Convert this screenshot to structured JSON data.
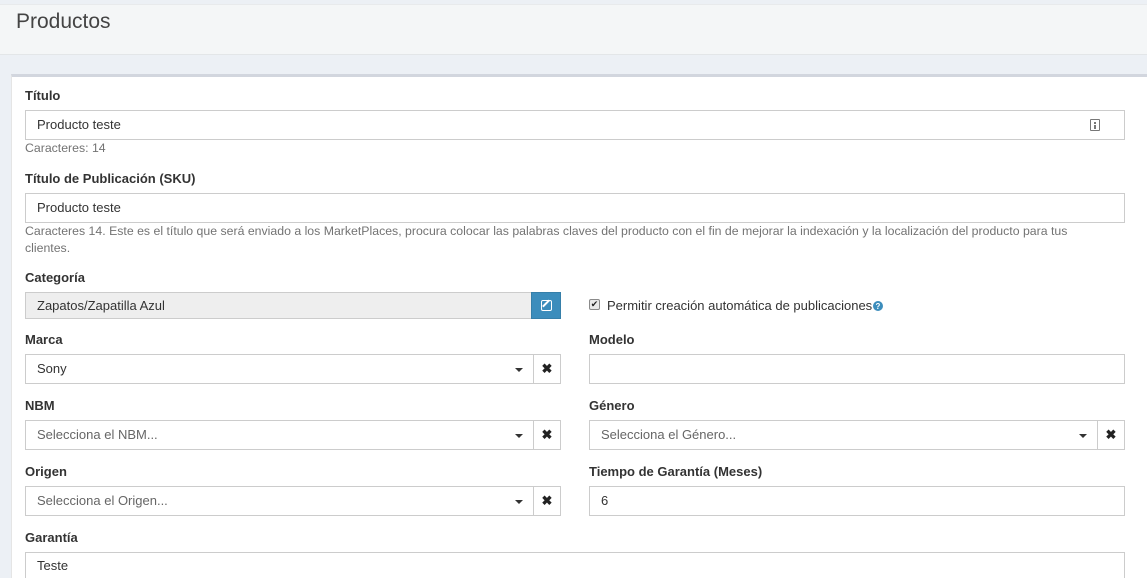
{
  "header": {
    "title": "Productos"
  },
  "form": {
    "titulo": {
      "label": "Título",
      "value": "Producto teste",
      "counter": "Caracteres: 14"
    },
    "titulo_publicacion": {
      "label": "Título de Publicación (SKU)",
      "value": "Producto teste",
      "help": "Caracteres 14. Este es el título que será enviado a los MarketPlaces, procura colocar las palabras claves del producto con el fin de mejorar la indexación y la localización del producto para tus clientes."
    },
    "categoria": {
      "label": "Categoría",
      "value": "Zapatos/Zapatilla Azul",
      "auto_publish_label": "Permitir creación automática de publicaciones",
      "auto_publish_checked": true
    },
    "marca": {
      "label": "Marca",
      "value": "Sony"
    },
    "modelo": {
      "label": "Modelo",
      "value": ""
    },
    "nbm": {
      "label": "NBM",
      "placeholder": "Selecciona el NBM..."
    },
    "genero": {
      "label": "Género",
      "placeholder": "Selecciona el Género..."
    },
    "origen": {
      "label": "Origen",
      "placeholder": "Selecciona el Origen..."
    },
    "tiempo_garantia": {
      "label": "Tiempo de Garantía (Meses)",
      "value": "6"
    },
    "garantia": {
      "label": "Garantía",
      "value": "Teste"
    }
  },
  "icons": {
    "clear": "✖",
    "check": "✔",
    "help": "?"
  },
  "colors": {
    "primary": "#3c8dbc",
    "background": "#ecf0f5"
  }
}
